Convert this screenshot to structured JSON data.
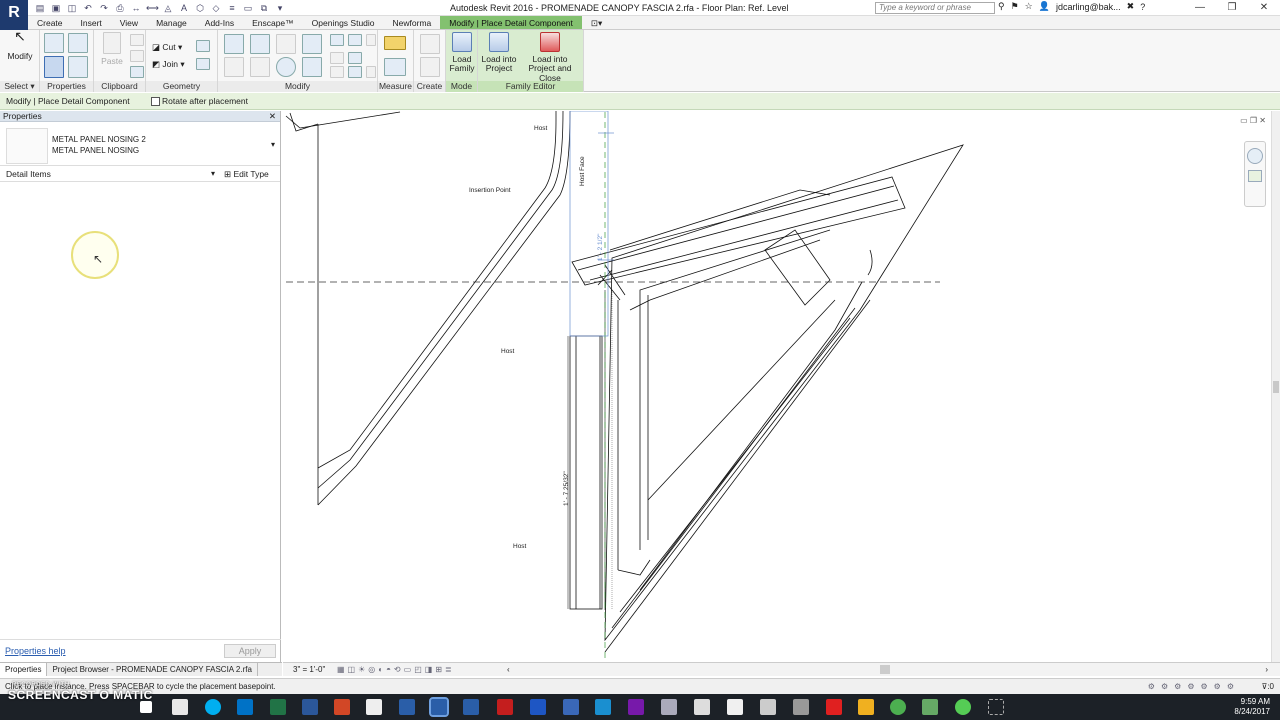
{
  "app": {
    "logo": "R",
    "title": "Autodesk Revit 2016 -    PROMENADE CANOPY FASCIA 2.rfa - Floor Plan: Ref. Level",
    "search_placeholder": "Type a keyword or phrase",
    "user": "jdcarling@bak...",
    "help": "?"
  },
  "tabs": [
    "Create",
    "Insert",
    "View",
    "Manage",
    "Add-Ins",
    "Enscape™",
    "Openings Studio",
    "Newforma",
    "Modify | Place Detail Component"
  ],
  "ribbon": {
    "modify_label": "Modify",
    "select_label": "Select",
    "properties_label": "Properties",
    "clipboard_label": "Clipboard",
    "paste_label": "Paste",
    "cut_label": "Cut",
    "join_label": "Join",
    "geometry_label": "Geometry",
    "modify_panel_label": "Modify",
    "measure_label": "Measure",
    "create_label": "Create",
    "mode_label": "Mode",
    "family_editor_label": "Family Editor",
    "load_family_line1": "Load",
    "load_family_line2": "Family",
    "load_project_line1": "Load into",
    "load_project_line2": "Project",
    "load_close_line1": "Load into",
    "load_close_line2": "Project and Close"
  },
  "options_bar": {
    "context": "Modify | Place Detail Component",
    "rotate_label": "Rotate after placement"
  },
  "properties": {
    "header": "Properties",
    "type_name_1": "METAL PANEL NOSING 2",
    "type_name_2": "METAL PANEL NOSING",
    "category": "Detail Items",
    "edit_type": "Edit Type",
    "help_link": "Properties help",
    "apply": "Apply"
  },
  "bottom_tabs": {
    "properties": "Properties",
    "project_browser": "Project Browser - PROMENADE CANOPY FASCIA 2.rfa"
  },
  "drawing": {
    "host_top": "Host",
    "insertion_point": "Insertion Point",
    "host_face": "Host Face",
    "host_mid": "Host",
    "host_bottom": "Host",
    "dim_vertical": "1' - 7 25/32\"",
    "dim_top": "1' - 2 1/2\""
  },
  "view_bar": {
    "scale": "3\" = 1'-0\""
  },
  "status": {
    "message": "Click to place instance. Press SPACEBAR to cycle the placement basepoint."
  },
  "watermark": {
    "small": "RECORDED WITH",
    "big": "SCREENCAST O MATIC"
  },
  "clock": {
    "time": "9:59 AM",
    "date": "8/24/2017"
  },
  "colors": {
    "context_tab": "#83c16f",
    "revit_blue": "#1e3a6e",
    "taskbar": "#1c2127",
    "cursor_highlight": "#f0e68c"
  }
}
